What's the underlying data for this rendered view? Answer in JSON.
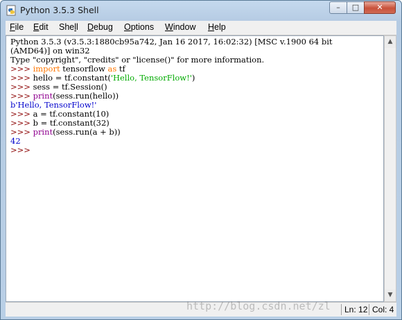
{
  "window": {
    "title": "Python 3.5.3 Shell",
    "icons": {
      "app": "python-idle-icon",
      "minimize": "minimize-icon",
      "maximize": "maximize-icon",
      "close": "close-icon"
    }
  },
  "menu": [
    {
      "label": "File",
      "underline": "F",
      "rest": "ile"
    },
    {
      "label": "Edit",
      "underline": "E",
      "rest": "dit"
    },
    {
      "label": "Shell",
      "pre": "She",
      "underline": "l",
      "rest": "l"
    },
    {
      "label": "Debug",
      "underline": "D",
      "rest": "ebug"
    },
    {
      "label": "Options",
      "underline": "O",
      "rest": "ptions"
    },
    {
      "label": "Window",
      "underline": "W",
      "rest": "indow"
    },
    {
      "label": "Help",
      "underline": "H",
      "rest": "elp"
    }
  ],
  "shell": {
    "banner1": "Python 3.5.3 (v3.5.3:1880cb95a742, Jan 16 2017, 16:02:32) [MSC v.1900 64 bit",
    "banner2": "(AMD64)] on win32",
    "banner3": "Type \"copyright\", \"credits\" or \"license()\" for more information.",
    "prompt": ">>> ",
    "l1_kw1": "import",
    "l1_mid": " tensorflow ",
    "l1_kw2": "as",
    "l1_end": " tf",
    "l2_pre": "hello = tf.constant(",
    "l2_str": "'Hello, TensorFlow!'",
    "l2_end": ")",
    "l3": "sess = tf.Session()",
    "l4_fn": "print",
    "l4_end": "(sess.run(hello))",
    "out1": "b'Hello, TensorFlow!'",
    "l5": "a = tf.constant(10)",
    "l6": "b = tf.constant(32)",
    "l7_fn": "print",
    "l7_end": "(sess.run(a + b))",
    "out2": "42",
    "last_prompt": ">>>"
  },
  "status": {
    "line": "Ln: 12",
    "col": "Col: 4"
  },
  "watermark": "http://blog.csdn.net/zl"
}
